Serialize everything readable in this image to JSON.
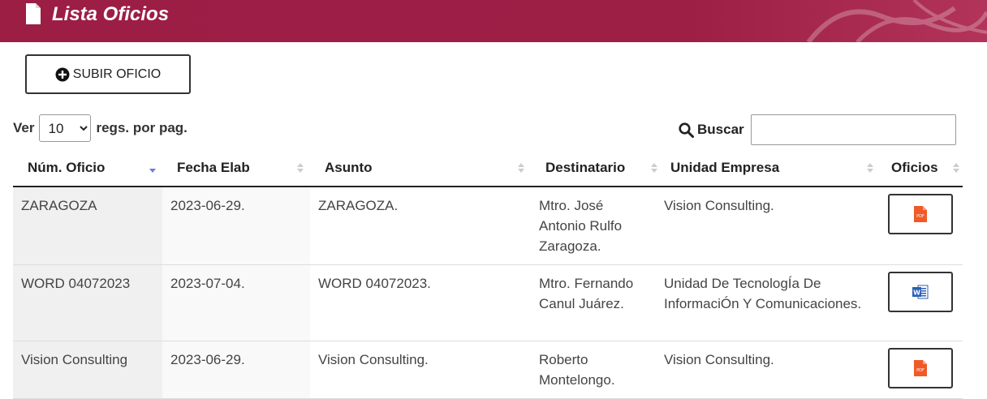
{
  "header": {
    "title": "Lista Oficios",
    "doc_icon": "file-icon"
  },
  "toolbar": {
    "upload_label": "SUBIR OFICIO",
    "upload_icon": "plus-circle-icon"
  },
  "length": {
    "prefix": "Ver",
    "value": "10",
    "suffix": "regs. por pag."
  },
  "search": {
    "label": "Buscar",
    "icon": "search-icon",
    "value": ""
  },
  "table": {
    "columns": [
      "Núm. Oficio",
      "Fecha Elab",
      "Asunto",
      "Destinatario",
      "Unidad Empresa",
      "Oficios"
    ],
    "rows": [
      {
        "num": "ZARAGOZA",
        "fecha": "2023-06-29.",
        "asunto": "ZARAGOZA.",
        "destinatario": "Mtro. José Antonio Rulfo Zaragoza.",
        "unidad": "Vision Consulting.",
        "file": "pdf-icon"
      },
      {
        "num": "WORD 04072023",
        "fecha": "2023-07-04.",
        "asunto": "WORD 04072023.",
        "destinatario": "Mtro. Fernando Canul Juárez.",
        "unidad": "Unidad De TecnologÍa De InformaciÓn Y Comunicaciones.",
        "file": "word-icon"
      },
      {
        "num": "Vision Consulting",
        "fecha": "2023-06-29.",
        "asunto": "Vision Consulting.",
        "destinatario": "Roberto Montelongo.",
        "unidad": "Vision Consulting.",
        "file": "pdf-icon"
      }
    ]
  },
  "colors": {
    "header_bg": "#9c1e45",
    "sort_active": "#6c7ae0",
    "pdf": "#f05a28",
    "word": "#2b5fb5"
  }
}
